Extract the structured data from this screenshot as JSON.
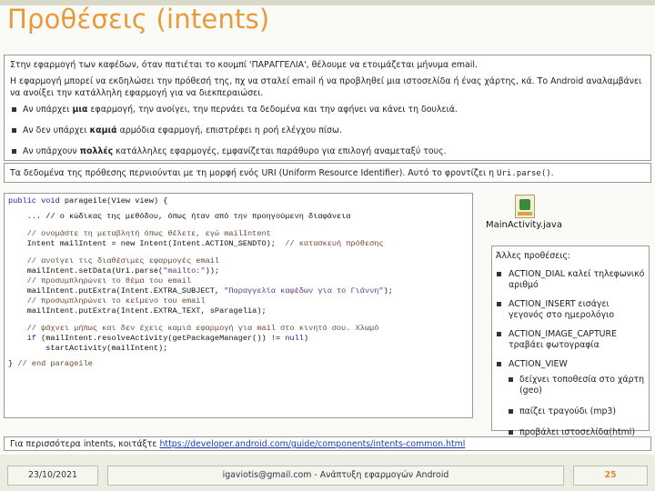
{
  "title": "Προθέσεις (intents)",
  "intro": {
    "p1": "Στην εφαρμογή των καφέδων, όταν πατιέται το κουμπί 'ΠΑΡΑΓΓΕΛΙΑ', θέλουμε να ετοιμάζεται μήνυμα email.",
    "p2": "Η εφαρμογή μπορεί να εκδηλώσει την πρόθεσή της, πχ να σταλεί email ή να προβληθεί μια ιστοσελίδα ή ένας χάρτης, κά. Το Android αναλαμβάνει να ανοίξει την κατάλληλη εφαρμογή για να διεκπεραιώσει.",
    "bullets": [
      {
        "pre": "Αν υπάρχει ",
        "bold": "μια",
        "post": " εφαρμογή, την ανοίγει, την περνάει τα δεδομένα και την αφήνει να κάνει τη δουλειά."
      },
      {
        "pre": "Αν δεν υπάρχει ",
        "bold": "καμιά",
        "post": " αρμόδια εφαρμογή, επιστρέφει η ροή ελέγχου πίσω."
      },
      {
        "pre": "Αν υπάρχουν ",
        "bold": "πολλές",
        "post": " κατάλληλες εφαρμογές, εμφανίζεται παράθυρο για επιλογή αναμεταξύ τους."
      }
    ]
  },
  "uri": {
    "text": "Τα δεδομένα της πρόθεσης περνιούνται με τη μορφή ενός URI (Uniform Resource Identifier). Αυτό το φροντίζει η ",
    "code": "Uri.parse()",
    "end": "."
  },
  "code": {
    "l1_kw": "public void",
    "l1_rest": " parageile(View view) {",
    "l2": "    ... // ο κώδικας της μεθόδου, όπως ήταν από την προηγούμενη διαφάνεια",
    "l3": "    // ονομάστε τη μεταβλητή όπως θέλετε, εγώ mailIntent",
    "l4_code": "    Intent mailIntent = new Intent(Intent.ACTION_SENDTO);",
    "l4_cm": "  // κατασκευή πρόθεσης",
    "l5": "    // ανοίγει τις διαθέσιμες εφαρμογές email",
    "l6_code": "    mailIntent.setData(Uri.parse(",
    "l6_str": "\"mailto:\"",
    "l6_end": "));",
    "l7": "    // προσυμπληρώνει το θέμα του email",
    "l8_code": "    mailIntent.putExtra(Intent.EXTRA_SUBJECT, ",
    "l8_str": "\"Παραγγελία καφέδων για το Γιάννη\"",
    "l8_end": ");",
    "l9": "    // προσυμπληρώνει το κείμενο του email",
    "l10": "    mailIntent.putExtra(Intent.EXTRA_TEXT, sParagelia);",
    "l11": "    // ψάχνει μήπως και δεν έχεις καμιά εφαρμογή για mail στο κινητό σου. Χλωμό",
    "l12_kw": "    if",
    "l12_code": " (mailIntent.resolveActivity(getPackageManager()) != ",
    "l12_null": "null",
    "l12_end": ")",
    "l13": "        startActivity(mailIntent);",
    "l14_code": "} ",
    "l14_cm": "// end parageile"
  },
  "file_icon": {
    "icon": "java-file-icon",
    "label": "MainActivity.java"
  },
  "side": {
    "head": "Άλλες προθέσεις:",
    "items": [
      "ACTION_DIAL καλεί τηλεφωνικό αριθμό",
      "ACTION_INSERT εισάγει γεγονός στο ημερολόγιο",
      "ACTION_IMAGE_CAPTURE τραβάει φωτογραφία",
      "ACTION_VIEW"
    ],
    "subitems": [
      "δείχνει τοποθεσία στο χάρτη (geo)",
      "παίζει τραγούδι (mp3)",
      "προβάλει ιστοσελίδα(html)"
    ]
  },
  "more": {
    "text": "Για περισσότερα intents, κοιτάξτε ",
    "link": "https://developer.android.com/guide/components/intents-common.html"
  },
  "footer": {
    "date": "23/10/2021",
    "center": "igaviotis@gmail.com - Ανάπτυξη εφαρμογών Android",
    "page": "25"
  }
}
